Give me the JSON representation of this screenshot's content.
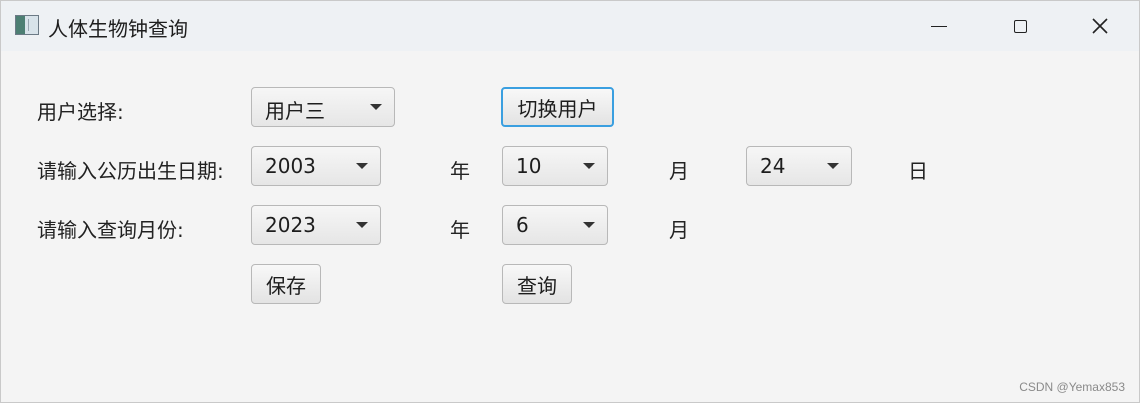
{
  "window": {
    "title": "人体生物钟查询"
  },
  "form": {
    "user_label": "用户选择:",
    "user_value": "用户三",
    "switch_user_button": "切换用户",
    "birth_label": "请输入公历出生日期:",
    "birth_year": "2003",
    "birth_year_unit": "年",
    "birth_month": "10",
    "birth_month_unit": "月",
    "birth_day": "24",
    "birth_day_unit": "日",
    "query_label": "请输入查询月份:",
    "query_year": "2023",
    "query_year_unit": "年",
    "query_month": "6",
    "query_month_unit": "月",
    "save_button": "保存",
    "query_button": "查询"
  },
  "watermark": "CSDN @Yemax853"
}
